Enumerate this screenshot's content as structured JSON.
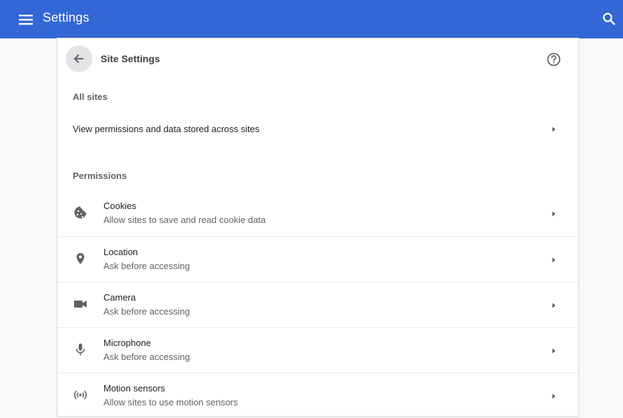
{
  "header": {
    "title": "Settings",
    "menu_icon": "hamburger-menu-icon",
    "search_icon": "search-icon",
    "color": "#3367d6"
  },
  "page": {
    "title": "Site Settings",
    "back_icon": "arrow-back-icon",
    "help_icon": "help-circle-icon"
  },
  "all_sites": {
    "header": "All sites",
    "link_label": "View permissions and data stored across sites"
  },
  "permissions": {
    "header": "Permissions",
    "items": [
      {
        "icon": "cookie-icon",
        "title": "Cookies",
        "subtitle": "Allow sites to save and read cookie data"
      },
      {
        "icon": "location-pin-icon",
        "title": "Location",
        "subtitle": "Ask before accessing"
      },
      {
        "icon": "camera-icon",
        "title": "Camera",
        "subtitle": "Ask before accessing"
      },
      {
        "icon": "microphone-icon",
        "title": "Microphone",
        "subtitle": "Ask before accessing"
      },
      {
        "icon": "motion-sensors-icon",
        "title": "Motion sensors",
        "subtitle": "Allow sites to use motion sensors"
      }
    ]
  }
}
